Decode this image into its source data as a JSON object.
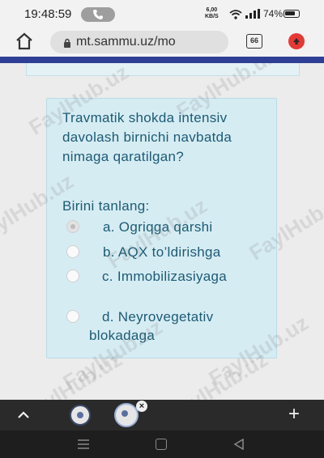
{
  "status_bar": {
    "time": "19:48:59",
    "net_speed_value": "6,00",
    "net_speed_unit": "KB/S",
    "battery": "74%",
    "icons": [
      "call-icon",
      "wifi-icon",
      "signal-icon",
      "battery-icon"
    ]
  },
  "browser": {
    "url": "mt.sammu.uz/mo",
    "tab_count": "66",
    "icons": [
      "home-icon",
      "lock-icon",
      "tabs-icon",
      "profile-icon"
    ]
  },
  "quiz": {
    "question": "Travmatik shokda intensiv davolash birnichi navbatda nimaga qaratilgan?",
    "prompt": "Birini tanlang:",
    "options": [
      {
        "label": "a. Ogriqga qarshi",
        "selected": true
      },
      {
        "label": "b. AQX to’ldirishga",
        "selected": false
      },
      {
        "label": "c. Immobilizasiyaga",
        "selected": false
      },
      {
        "label": "d. Neyrovegetativ blokadaga",
        "selected": false
      }
    ]
  },
  "watermark": "FaylHub.uz",
  "bottom_bar": {
    "new_tab": "+",
    "close_mark": "×",
    "icons": [
      "chevron-up-icon",
      "tab-thumbnail-icon",
      "close-icon",
      "plus-icon"
    ]
  },
  "nav_bar": {
    "icons": [
      "recents-icon",
      "home-icon",
      "back-icon"
    ]
  },
  "colors": {
    "accent_line": "#2f3f95",
    "card_bg": "#d6ecf3",
    "text": "#1c5b74",
    "bottom_bar": "#2a2a2a"
  }
}
